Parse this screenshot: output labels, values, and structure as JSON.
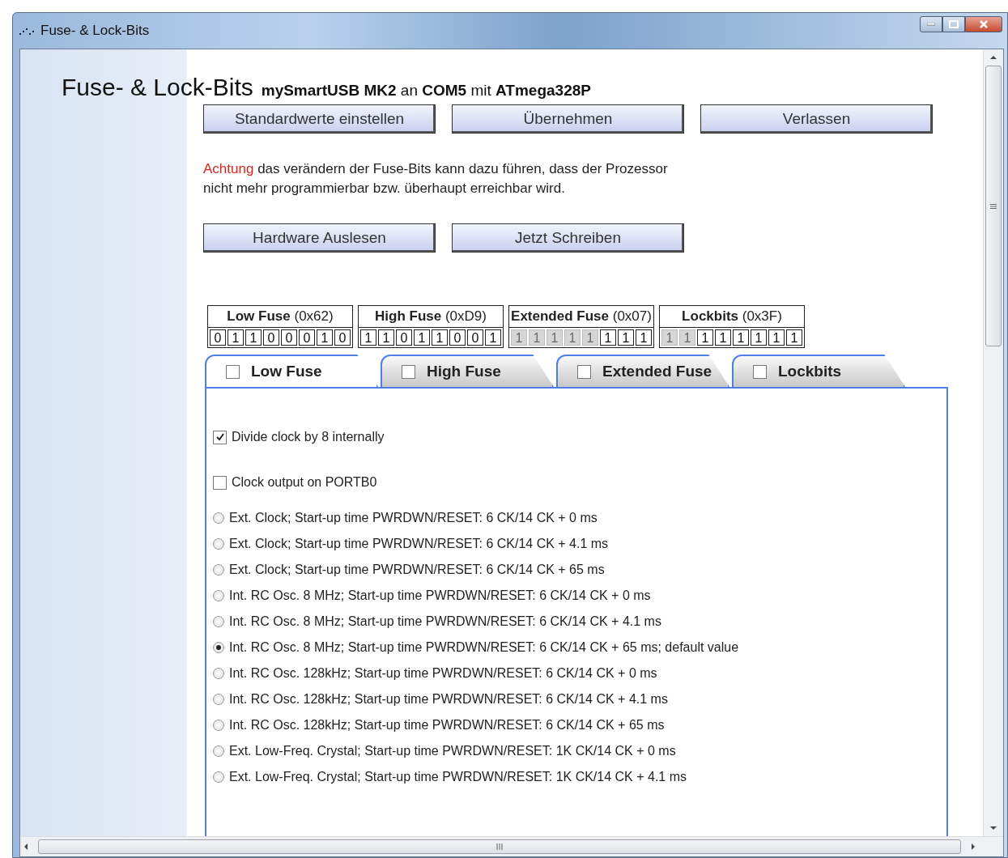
{
  "window": {
    "title": "Fuse- & Lock-Bits"
  },
  "heading": {
    "title": "Fuse- & Lock-Bits",
    "subtitle": "**mySmartUSB MK2** an **COM5** mit **ATmega328P**"
  },
  "top_buttons": [
    "Standardwerte einstellen",
    "Übernehmen",
    "Verlassen"
  ],
  "warning": {
    "highlight": "Achtung",
    "text": "das verändern der Fuse-Bits kann dazu führen, dass der Prozessor nicht mehr programmierbar bzw. überhaupt erreichbar wird."
  },
  "action_buttons": [
    "Hardware Auslesen",
    "Jetzt Schreiben"
  ],
  "fuse_tables": [
    {
      "name": "Low Fuse",
      "value": "(0x62)",
      "bits": [
        {
          "text": "0",
          "disabled": false
        },
        {
          "text": "1",
          "disabled": false
        },
        {
          "text": "1",
          "disabled": false
        },
        {
          "text": "0",
          "disabled": false
        },
        {
          "text": "0",
          "disabled": false
        },
        {
          "text": "0",
          "disabled": false
        },
        {
          "text": "1",
          "disabled": false
        },
        {
          "text": "0",
          "disabled": false
        }
      ]
    },
    {
      "name": "High Fuse",
      "value": "(0xD9)",
      "bits": [
        {
          "text": "1",
          "disabled": false
        },
        {
          "text": "1",
          "disabled": false
        },
        {
          "text": "0",
          "disabled": false
        },
        {
          "text": "1",
          "disabled": false
        },
        {
          "text": "1",
          "disabled": false
        },
        {
          "text": "0",
          "disabled": false
        },
        {
          "text": "0",
          "disabled": false
        },
        {
          "text": "1",
          "disabled": false
        }
      ]
    },
    {
      "name": "Extended Fuse",
      "value": "(0x07)",
      "bits": [
        {
          "text": "1",
          "disabled": true
        },
        {
          "text": "1",
          "disabled": true
        },
        {
          "text": "1",
          "disabled": true
        },
        {
          "text": "1",
          "disabled": true
        },
        {
          "text": "1",
          "disabled": true
        },
        {
          "text": "1",
          "disabled": false
        },
        {
          "text": "1",
          "disabled": false
        },
        {
          "text": "1",
          "disabled": false
        }
      ]
    },
    {
      "name": "Lockbits",
      "value": "(0x3F)",
      "bits": [
        {
          "text": "1",
          "disabled": true
        },
        {
          "text": "1",
          "disabled": true
        },
        {
          "text": "1",
          "disabled": false
        },
        {
          "text": "1",
          "disabled": false
        },
        {
          "text": "1",
          "disabled": false
        },
        {
          "text": "1",
          "disabled": false
        },
        {
          "text": "1",
          "disabled": false
        },
        {
          "text": "1",
          "disabled": false
        }
      ]
    }
  ],
  "tabs": [
    {
      "label": "Low Fuse",
      "selected": true,
      "checked": false
    },
    {
      "label": "High Fuse",
      "selected": false,
      "checked": false
    },
    {
      "label": "Extended Fuse",
      "selected": false,
      "checked": false
    },
    {
      "label": "Lockbits",
      "selected": false,
      "checked": false
    }
  ],
  "options": [
    {
      "kind": "checkbox",
      "label": "Divide clock by 8 internally",
      "checked": true
    },
    {
      "kind": "checkbox",
      "label": "Clock output on PORTB0",
      "checked": false
    },
    {
      "kind": "radio",
      "label": "Ext. Clock; Start-up time PWRDWN/RESET: 6 CK/14 CK + 0 ms",
      "checked": false
    },
    {
      "kind": "radio",
      "label": "Ext. Clock; Start-up time PWRDWN/RESET: 6 CK/14 CK + 4.1 ms",
      "checked": false
    },
    {
      "kind": "radio",
      "label": "Ext. Clock; Start-up time PWRDWN/RESET: 6 CK/14 CK + 65 ms",
      "checked": false
    },
    {
      "kind": "radio",
      "label": "Int. RC Osc. 8 MHz; Start-up time PWRDWN/RESET: 6 CK/14 CK + 0 ms",
      "checked": false
    },
    {
      "kind": "radio",
      "label": "Int. RC Osc. 8 MHz; Start-up time PWRDWN/RESET: 6 CK/14 CK + 4.1 ms",
      "checked": false
    },
    {
      "kind": "radio",
      "label": "Int. RC Osc. 8 MHz; Start-up time PWRDWN/RESET: 6 CK/14 CK + 65 ms; default value",
      "checked": true
    },
    {
      "kind": "radio",
      "label": "Int. RC Osc. 128kHz; Start-up time PWRDWN/RESET: 6 CK/14 CK + 0 ms",
      "checked": false
    },
    {
      "kind": "radio",
      "label": "Int. RC Osc. 128kHz; Start-up time PWRDWN/RESET: 6 CK/14 CK + 4.1 ms",
      "checked": false
    },
    {
      "kind": "radio",
      "label": "Int. RC Osc. 128kHz; Start-up time PWRDWN/RESET: 6 CK/14 CK + 65 ms",
      "checked": false
    },
    {
      "kind": "radio",
      "label": "Ext. Low-Freq. Crystal; Start-up time PWRDWN/RESET: 1K CK/14 CK + 0 ms",
      "checked": false
    },
    {
      "kind": "radio",
      "label": "Ext. Low-Freq. Crystal; Start-up time PWRDWN/RESET: 1K CK/14 CK + 4.1 ms",
      "checked": false
    }
  ]
}
